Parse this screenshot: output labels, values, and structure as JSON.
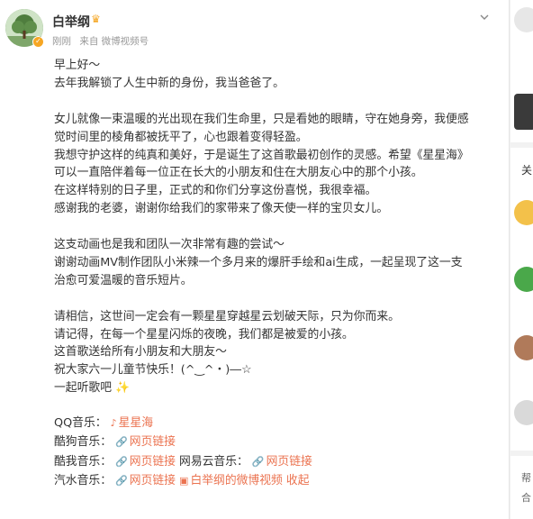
{
  "post": {
    "author": "白举纲",
    "time": "刚刚",
    "source": "来自 微博视频号",
    "lines": [
      "早上好～",
      "去年我解锁了人生中新的身份，我当爸爸了。",
      "",
      "女儿就像一束温暖的光出现在我们生命里，只是看她的眼睛，守在她身旁，我便感",
      "觉时间里的棱角都被抚平了，心也跟着变得轻盈。",
      "我想守护这样的纯真和美好，于是诞生了这首歌最初创作的灵感。希望《星星海》",
      "可以一直陪伴着每一位正在长大的小朋友和住在大朋友心中的那个小孩。",
      "在这样特别的日子里，正式的和你们分享这份喜悦，我很幸福。",
      "感谢我的老婆，谢谢你给我们的家带来了像天使一样的宝贝女儿。",
      "",
      "这支动画也是我和团队一次非常有趣的尝试～",
      "谢谢动画MV制作团队小米辣一个多月来的爆肝手绘和ai生成，一起呈现了这一支",
      "治愈可爱温暖的音乐短片。",
      "",
      "请相信，这世间一定会有一颗星星穿越星云划破天际，只为你而来。",
      "请记得，在每一个星星闪烁的夜晚，我们都是被爱的小孩。",
      "这首歌送给所有小朋友和大朋友～",
      "祝大家六一儿童节快乐！(^‿^・)―☆",
      "一起听歌吧 ✨"
    ],
    "links": {
      "qq_label": "QQ音乐：",
      "qq_link": "星星海",
      "kugou_label": "酷狗音乐：",
      "kugou_link": "网页链接",
      "kuwo_label": "酷我音乐：",
      "kuwo_link": "网页链接",
      "netease_label": "网易云音乐：",
      "netease_link": "网页链接",
      "qishui_label": "汽水音乐：",
      "qishui_link": "网页链接",
      "video_link": "白举纲的微博视频",
      "collapse": "收起"
    }
  },
  "sidebar": {
    "fragment_1": "关",
    "fragment_2": "帮",
    "fragment_3": "合"
  },
  "colors": {
    "link": "#eb7350",
    "badge": "#f6a623"
  }
}
